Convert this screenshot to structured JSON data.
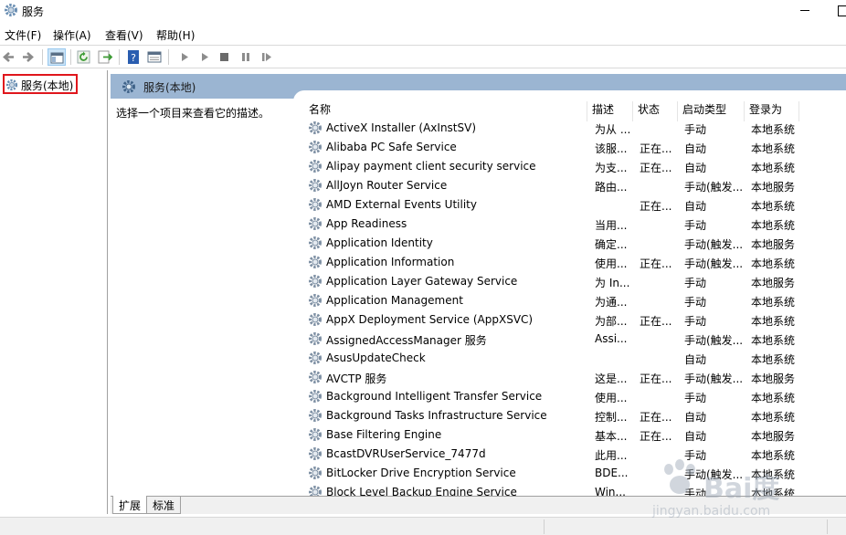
{
  "window": {
    "title": "服务"
  },
  "menu": [
    "文件(F)",
    "操作(A)",
    "查看(V)",
    "帮助(H)"
  ],
  "tree": {
    "root_label": "服务(本地)"
  },
  "panel": {
    "header_title": "服务(本地)",
    "description": "选择一个项目来查看它的描述。"
  },
  "columns": [
    "名称",
    "描述",
    "状态",
    "启动类型",
    "登录为"
  ],
  "services": [
    {
      "name": "ActiveX Installer (AxInstSV)",
      "desc": "为从 ...",
      "status": "",
      "startup": "手动",
      "logon": "本地系统"
    },
    {
      "name": "Alibaba PC Safe Service",
      "desc": "该服...",
      "status": "正在...",
      "startup": "自动",
      "logon": "本地系统"
    },
    {
      "name": "Alipay payment client security service",
      "desc": "为支...",
      "status": "正在...",
      "startup": "自动",
      "logon": "本地系统"
    },
    {
      "name": "AllJoyn Router Service",
      "desc": "路由...",
      "status": "",
      "startup": "手动(触发...",
      "logon": "本地服务"
    },
    {
      "name": "AMD External Events Utility",
      "desc": "",
      "status": "正在...",
      "startup": "自动",
      "logon": "本地系统"
    },
    {
      "name": "App Readiness",
      "desc": "当用...",
      "status": "",
      "startup": "手动",
      "logon": "本地系统"
    },
    {
      "name": "Application Identity",
      "desc": "确定...",
      "status": "",
      "startup": "手动(触发...",
      "logon": "本地服务"
    },
    {
      "name": "Application Information",
      "desc": "使用...",
      "status": "正在...",
      "startup": "手动(触发...",
      "logon": "本地系统"
    },
    {
      "name": "Application Layer Gateway Service",
      "desc": "为 In...",
      "status": "",
      "startup": "手动",
      "logon": "本地服务"
    },
    {
      "name": "Application Management",
      "desc": "为通...",
      "status": "",
      "startup": "手动",
      "logon": "本地系统"
    },
    {
      "name": "AppX Deployment Service (AppXSVC)",
      "desc": "为部...",
      "status": "正在...",
      "startup": "手动",
      "logon": "本地系统"
    },
    {
      "name": "AssignedAccessManager 服务",
      "desc": "Assi...",
      "status": "",
      "startup": "手动(触发...",
      "logon": "本地系统"
    },
    {
      "name": "AsusUpdateCheck",
      "desc": "",
      "status": "",
      "startup": "自动",
      "logon": "本地系统"
    },
    {
      "name": "AVCTP 服务",
      "desc": "这是...",
      "status": "正在...",
      "startup": "手动(触发...",
      "logon": "本地服务"
    },
    {
      "name": "Background Intelligent Transfer Service",
      "desc": "使用...",
      "status": "",
      "startup": "手动",
      "logon": "本地系统"
    },
    {
      "name": "Background Tasks Infrastructure Service",
      "desc": "控制...",
      "status": "正在...",
      "startup": "自动",
      "logon": "本地系统"
    },
    {
      "name": "Base Filtering Engine",
      "desc": "基本...",
      "status": "正在...",
      "startup": "自动",
      "logon": "本地服务"
    },
    {
      "name": "BcastDVRUserService_7477d",
      "desc": "此用...",
      "status": "",
      "startup": "手动",
      "logon": "本地系统"
    },
    {
      "name": "BitLocker Drive Encryption Service",
      "desc": "BDE...",
      "status": "",
      "startup": "手动(触发...",
      "logon": "本地系统"
    },
    {
      "name": "Block Level Backup Engine Service",
      "desc": "Win...",
      "status": "",
      "startup": "手动",
      "logon": "本地系统"
    }
  ],
  "tabs": [
    "扩展",
    "标准"
  ],
  "watermark": {
    "logo": "Bai度",
    "url": "jingyan.baidu.com"
  },
  "colors": {
    "header_bg": "#9bb5d2",
    "highlight_border": "#e0161c"
  }
}
